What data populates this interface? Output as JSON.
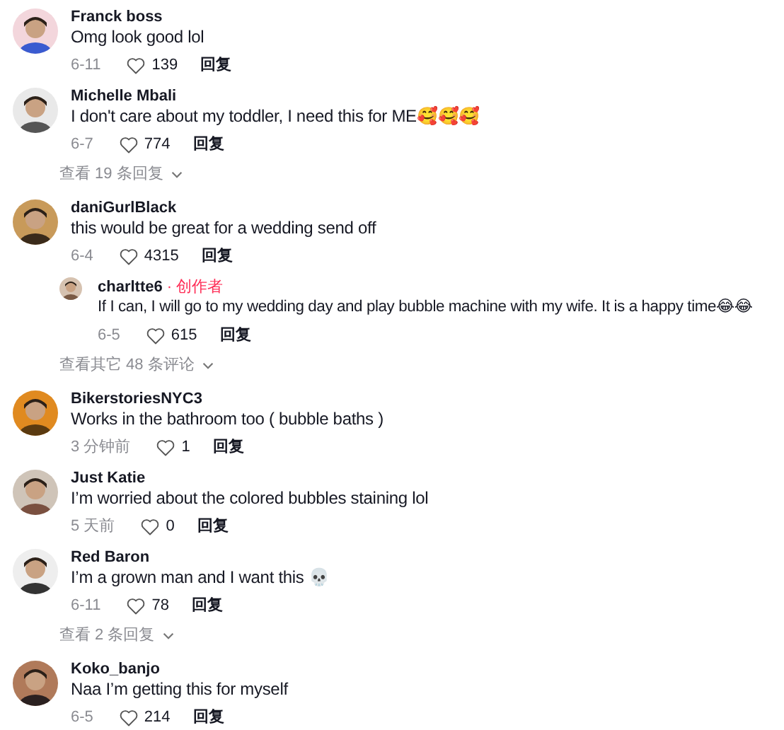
{
  "comments": [
    {
      "author": "Franck boss",
      "text": "Omg look good lol",
      "date": "6-11",
      "likes": "139",
      "reply_label": "回复"
    },
    {
      "author": "Michelle Mbali",
      "text": "I don't care about my toddler, I need this for ME🥰🥰🥰",
      "date": "6-7",
      "likes": "774",
      "reply_label": "回复",
      "more": "查看 19 条回复"
    },
    {
      "author": "daniGurlBlack",
      "text": "this would be great for a wedding send off",
      "date": "6-4",
      "likes": "4315",
      "reply_label": "回复",
      "replies": [
        {
          "author": "charltte6",
          "badge": "· 创作者",
          "text": "If I can, I will go to my wedding day and play bubble machine with my wife. It is a happy time😂😂",
          "date": "6-5",
          "likes": "615",
          "reply_label": "回复"
        }
      ],
      "more": "查看其它 48 条评论"
    },
    {
      "author": "BikerstoriesNYC3",
      "text": "Works in the bathroom too ( bubble baths )",
      "date": "3 分钟前",
      "likes": "1",
      "reply_label": "回复"
    },
    {
      "author": "Just Katie",
      "text": "I’m worried about the colored bubbles staining lol",
      "date": "5 天前",
      "likes": "0",
      "reply_label": "回复"
    },
    {
      "author": "Red Baron",
      "text": "I’m a grown man and I want this 💀",
      "date": "6-11",
      "likes": "78",
      "reply_label": "回复",
      "more": "查看 2 条回复"
    },
    {
      "author": "Koko_banjo",
      "text": "Naa I’m getting this for myself",
      "date": "6-5",
      "likes": "214",
      "reply_label": "回复"
    }
  ]
}
